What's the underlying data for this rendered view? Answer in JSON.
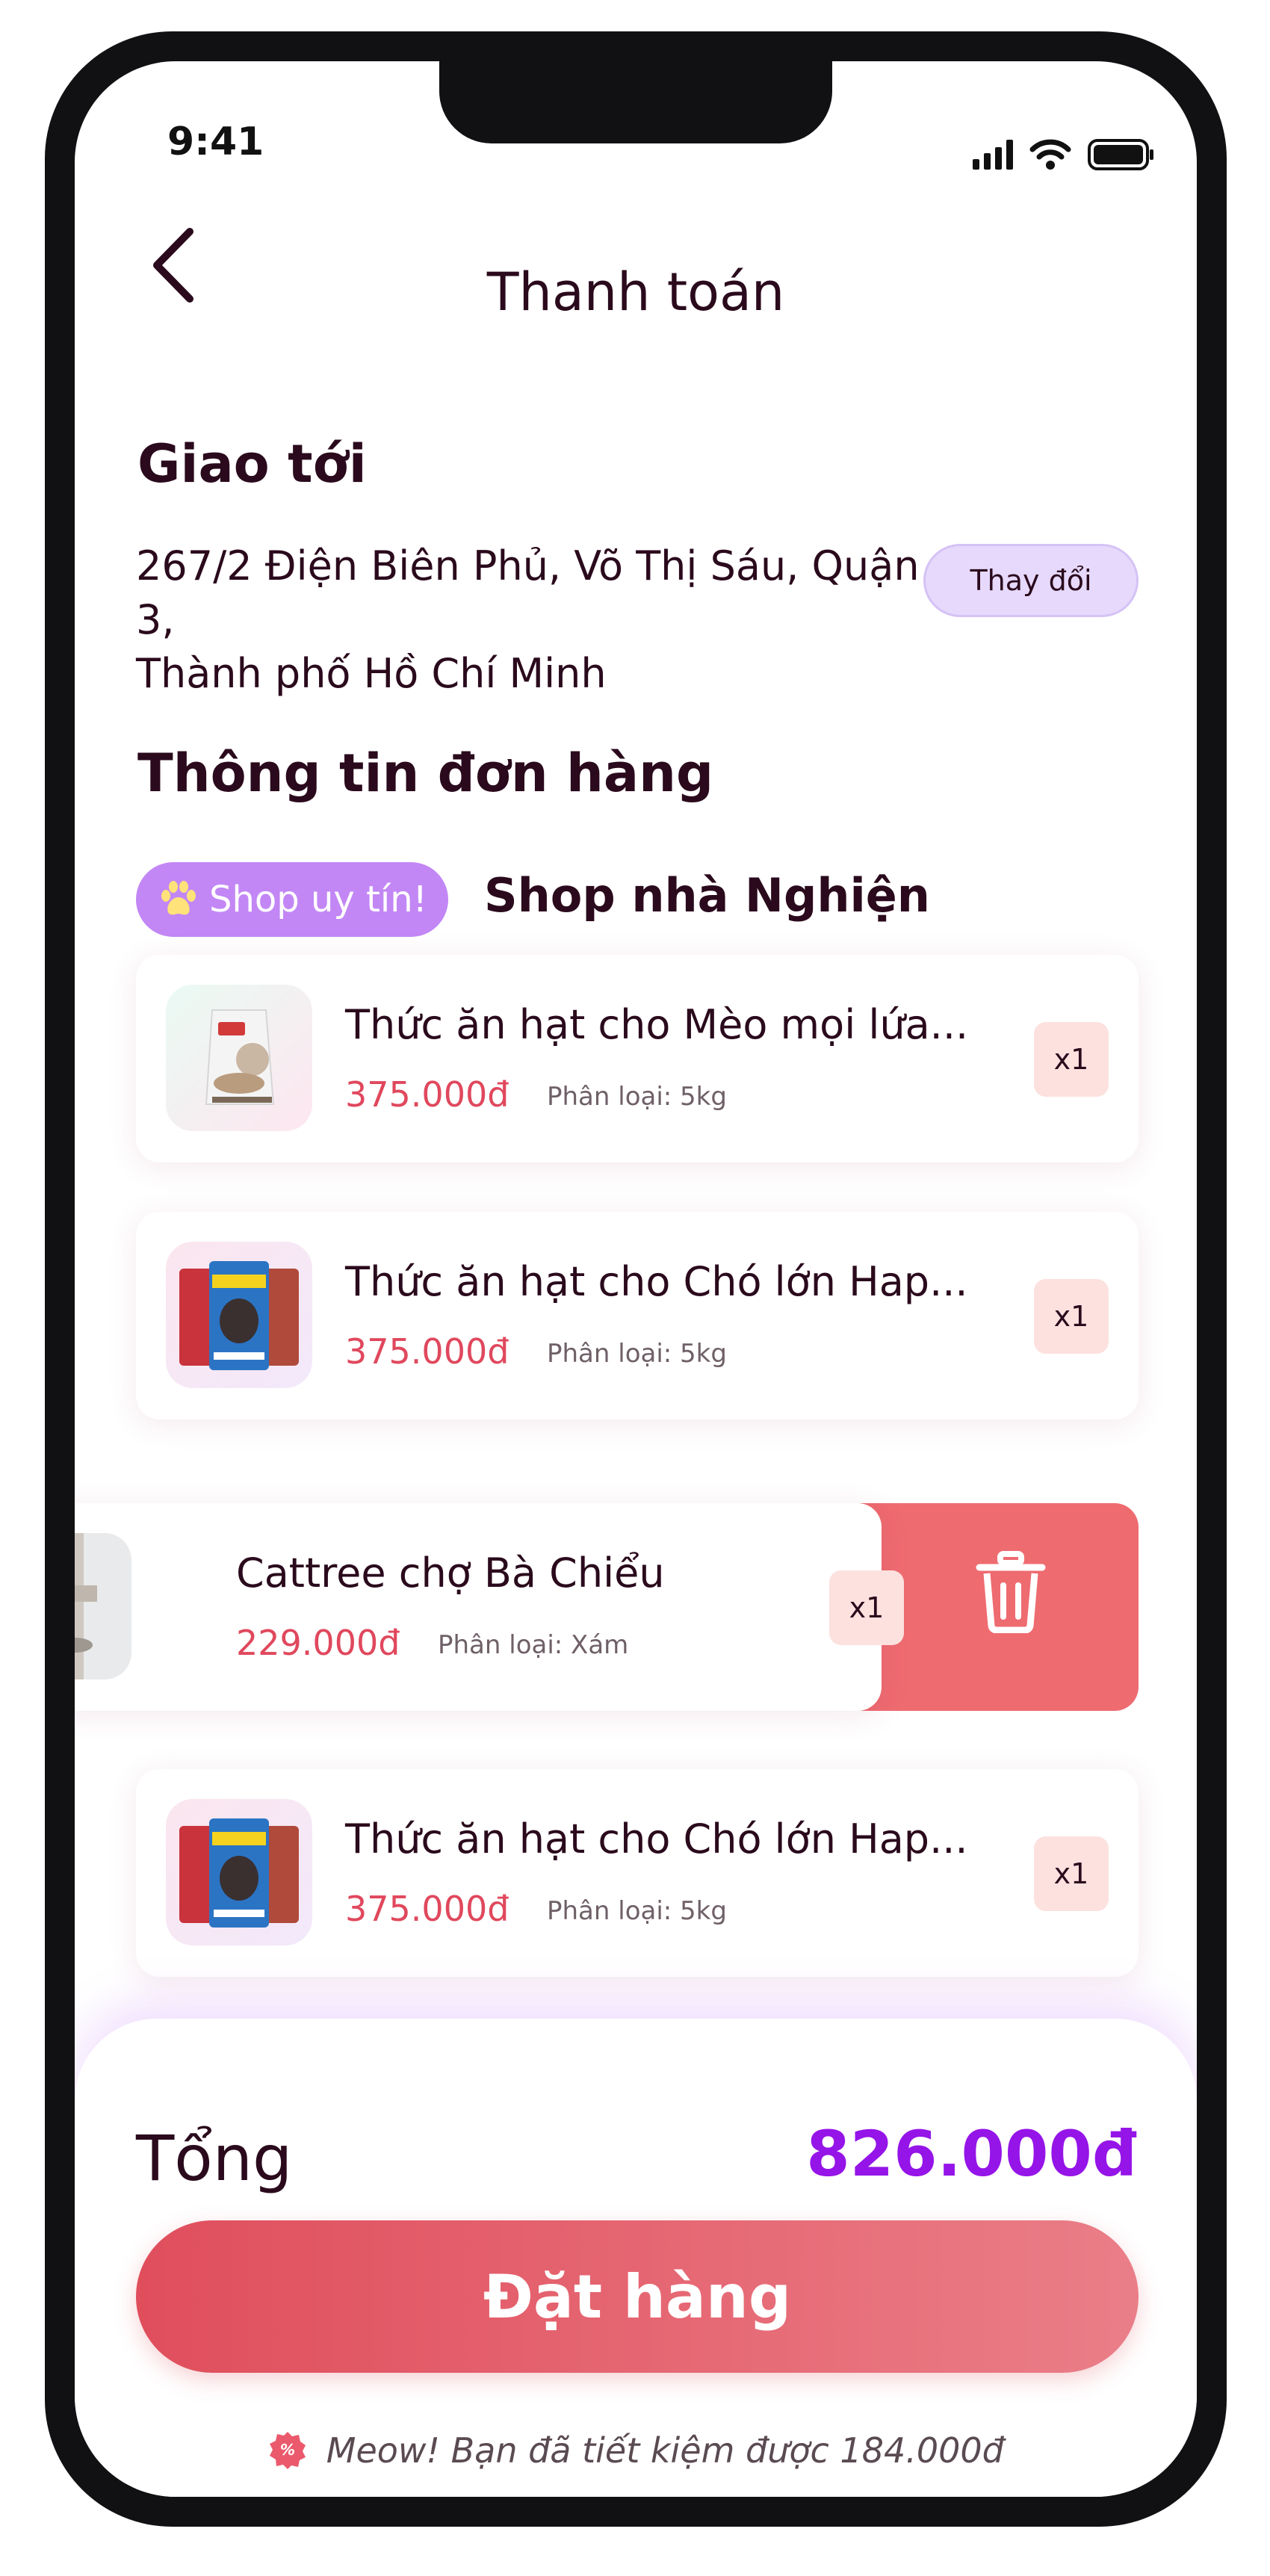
{
  "status_bar": {
    "time": "9:41"
  },
  "header": {
    "title": "Thanh toán"
  },
  "delivery": {
    "section_title": "Giao tới",
    "address_line1": "267/2 Điện Biên Phủ, Võ Thị Sáu, Quận 3,",
    "address_line2": "Thành phố Hồ Chí Minh",
    "change_label": "Thay đổi"
  },
  "order": {
    "section_title": "Thông tin đơn hàng",
    "trust_badge": "Shop uy tín!",
    "shop_name": "Shop nhà Nghiện",
    "items": [
      {
        "name": "Thức ăn hạt cho Mèo mọi lứa...",
        "price": "375.000đ",
        "variant": "Phân loại: 5kg",
        "qty": "x1",
        "thumb": "cat-food-bag"
      },
      {
        "name": "Thức ăn hạt cho Chó lớn Hap...",
        "price": "375.000đ",
        "variant": "Phân loại: 5kg",
        "qty": "x1",
        "thumb": "dog-food-bags"
      },
      {
        "name": "Cattree chợ Bà Chiểu",
        "price": "229.000đ",
        "variant": "Phân loại: Xám",
        "qty": "x1",
        "thumb": "cat-tree"
      },
      {
        "name": "Thức ăn hạt cho Chó lớn Hap...",
        "price": "375.000đ",
        "variant": "Phân loại: 5kg",
        "qty": "x1",
        "thumb": "dog-food-bags"
      }
    ]
  },
  "summary": {
    "total_label": "Tổng",
    "total_value": "826.000đ",
    "order_button": "Đặt hàng",
    "savings_text": "Meow! Bạn đã tiết kiệm được 184.000đ"
  },
  "colors": {
    "accent_purple": "#9514e8",
    "price_red": "#e0485d",
    "delete_red": "#ee6b70",
    "badge_purple": "#c287f5"
  },
  "icons": [
    "back-chevron-icon",
    "signal-icon",
    "wifi-icon",
    "battery-icon",
    "paw-icon",
    "trash-icon",
    "discount-badge-icon"
  ]
}
